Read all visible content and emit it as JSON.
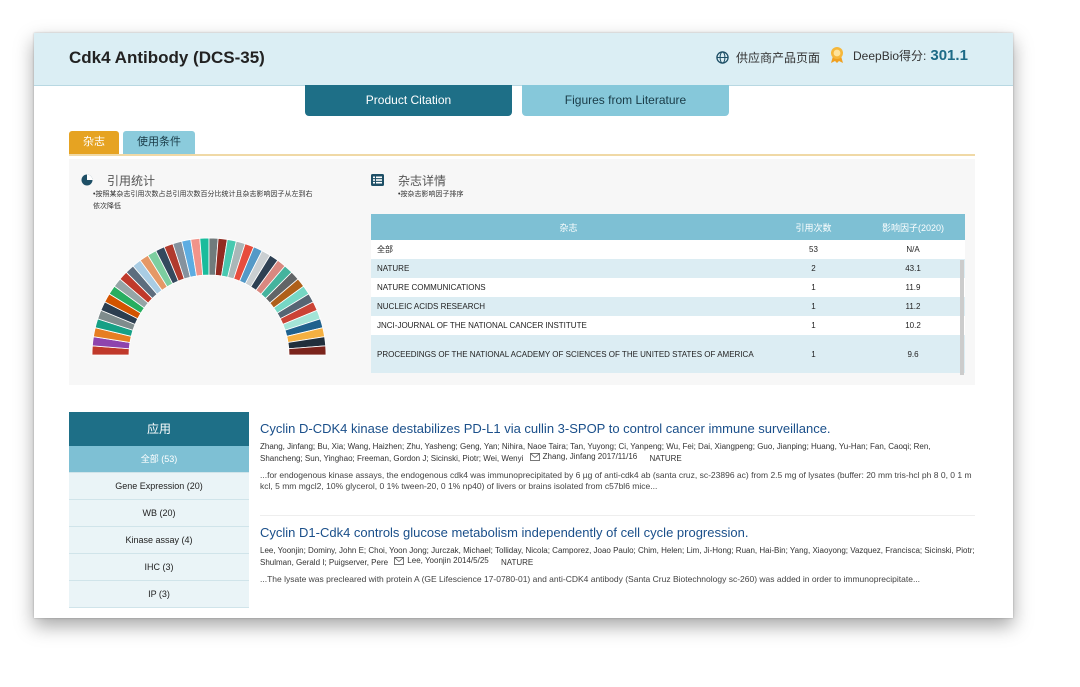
{
  "header": {
    "title": "Cdk4 Antibody (DCS-35)",
    "supplier_label": "供应商产品页面",
    "score_label": "DeepBio得分:",
    "score_value": "301.1"
  },
  "main_tabs": [
    {
      "label": "Product Citation",
      "active": true
    },
    {
      "label": "Figures from Literature",
      "active": false
    }
  ],
  "sub_tabs": [
    {
      "label": "杂志",
      "active": true
    },
    {
      "label": "使用条件",
      "active": false
    }
  ],
  "stats": {
    "title": "引用统计",
    "note": "•按照某杂志引用次数占总引用次数百分比统计且杂志影响因子从左到右依次降低"
  },
  "journals": {
    "title": "杂志详情",
    "note": "•按杂志影响因子排序",
    "columns": [
      "杂志",
      "引用次数",
      "影响因子(2020)"
    ],
    "rows": [
      {
        "name": "全部",
        "count": "53",
        "impact": "N/A"
      },
      {
        "name": "NATURE",
        "count": "2",
        "impact": "43.1"
      },
      {
        "name": "NATURE COMMUNICATIONS",
        "count": "1",
        "impact": "11.9"
      },
      {
        "name": "NUCLEIC ACIDS RESEARCH",
        "count": "1",
        "impact": "11.2"
      },
      {
        "name": "JNCI-JOURNAL OF THE NATIONAL CANCER INSTITUTE",
        "count": "1",
        "impact": "10.2"
      },
      {
        "name": "PROCEEDINGS OF THE NATIONAL ACADEMY OF SCIENCES OF THE UNITED STATES OF AMERICA",
        "count": "1",
        "impact": "9.6"
      }
    ]
  },
  "sidebar": {
    "title": "应用",
    "items": [
      {
        "label": "全部 (53)",
        "active": true
      },
      {
        "label": "Gene Expression (20)"
      },
      {
        "label": "WB (20)"
      },
      {
        "label": "Kinase assay (4)"
      },
      {
        "label": "IHC (3)"
      },
      {
        "label": "IP (3)"
      }
    ]
  },
  "citations": [
    {
      "title": "Cyclin D-CDK4 kinase destabilizes PD-L1 via cullin 3-SPOP to control cancer immune surveillance.",
      "authors": "Zhang, Jinfang; Bu, Xia; Wang, Haizhen; Zhu, Yasheng; Geng, Yan; Nihira, Naoe Taira; Tan, Yuyong; Ci, Yanpeng; Wu, Fei; Dai, Xiangpeng; Guo, Jianping; Huang, Yu-Han; Fan, Caoqi; Ren, Shancheng; Sun, Yinghao; Freeman, Gordon J; Sicinski, Piotr; Wei, Wenyi",
      "corresponding": "Zhang, Jinfang 2017/11/16",
      "journal": "NATURE",
      "excerpt": "...for endogenous kinase assays, the endogenous cdk4 was immunoprecipitated by 6 µg of anti-cdk4 ab (santa cruz, sc-23896 ac) from 2.5 mg of lysates (buffer: 20 mm tris-hcl ph 8 0, 0 1 m kcl, 5 mm mgcl2, 10% glycerol, 0 1% tween-20, 0 1% np40) of livers or brains isolated from c57bl6 mice..."
    },
    {
      "title": "Cyclin D1-Cdk4 controls glucose metabolism independently of cell cycle progression.",
      "authors": "Lee, Yoonjin; Dominy, John E; Choi, Yoon Jong; Jurczak, Michael; Tolliday, Nicola; Camporez, Joao Paulo; Chim, Helen; Lim, Ji-Hong; Ruan, Hai-Bin; Yang, Xiaoyong; Vazquez, Francisca; Sicinski, Piotr; Shulman, Gerald I; Puigserver, Pere",
      "corresponding": "Lee, Yoonjin 2014/5/25",
      "journal": "NATURE",
      "excerpt": "...The lysate was precleared with protein A (GE Lifescience 17-0780-01) and anti-CDK4 antibody (Santa Cruz Biotechnology sc-260) was added in order to immunoprecipitate..."
    }
  ],
  "donut_colors": [
    "#c0392b",
    "#8e44ad",
    "#e67e22",
    "#16a085",
    "#7f8c8d",
    "#2c3e50",
    "#d35400",
    "#27ae60",
    "#95a5a6",
    "#c0392b",
    "#5d6d7e",
    "#a9cce3",
    "#e59866",
    "#7dcea0",
    "#34495e",
    "#b03a2e",
    "#85929e",
    "#5dade2",
    "#f1948a",
    "#1abc9c",
    "#707b7c",
    "#922b21",
    "#48c9b0",
    "#aab7b8",
    "#e74c3c",
    "#5499c7",
    "#cacfd2",
    "#2e4053",
    "#d98880",
    "#45b39d",
    "#626567",
    "#af601a",
    "#76d7c4",
    "#566573",
    "#cb4335",
    "#a3e4d7",
    "#1f618d",
    "#f5b041",
    "#212f3c",
    "#7b241c"
  ]
}
